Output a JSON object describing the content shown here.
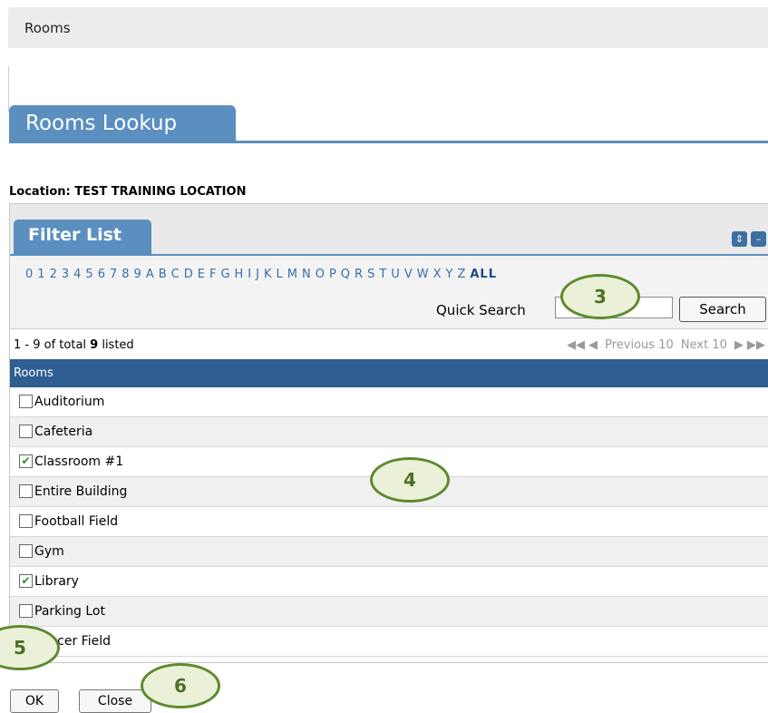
{
  "topbar": {
    "title": "Rooms"
  },
  "lookup": {
    "tab_title": "Rooms Lookup"
  },
  "location": {
    "text": "Location: TEST TRAINING LOCATION"
  },
  "filter": {
    "tab_title": "Filter List",
    "letters": [
      "0",
      "1",
      "2",
      "3",
      "4",
      "5",
      "6",
      "7",
      "8",
      "9",
      "A",
      "B",
      "C",
      "D",
      "E",
      "F",
      "G",
      "H",
      "I",
      "J",
      "K",
      "L",
      "M",
      "N",
      "O",
      "P",
      "Q",
      "R",
      "S",
      "T",
      "U",
      "V",
      "W",
      "X",
      "Y",
      "Z"
    ],
    "all_label": "ALL",
    "quick_search_label": "Quick Search",
    "quick_search_value": "",
    "search_button": "Search"
  },
  "list": {
    "range_text": "1 - 9 of total ",
    "total": "9",
    "listed_text": " listed",
    "previous_label": "Previous 10",
    "next_label": "Next 10",
    "column_header": "Rooms",
    "rows": [
      {
        "label": "Auditorium",
        "checked": false
      },
      {
        "label": "Cafeteria",
        "checked": false
      },
      {
        "label": "Classroom #1",
        "checked": true
      },
      {
        "label": "Entire Building",
        "checked": false
      },
      {
        "label": "Football Field",
        "checked": false
      },
      {
        "label": "Gym",
        "checked": false
      },
      {
        "label": "Library",
        "checked": true
      },
      {
        "label": "Parking Lot",
        "checked": false
      },
      {
        "label": "Soccer Field",
        "checked": false
      }
    ]
  },
  "actions": {
    "ok_label": "OK",
    "close_label": "Close"
  },
  "callouts": [
    "3",
    "4",
    "5",
    "6"
  ],
  "colors": {
    "accent": "#5a8fc0",
    "header": "#2f5e93",
    "check": "#2e8b2e",
    "callout_border": "#5e8a2e"
  }
}
